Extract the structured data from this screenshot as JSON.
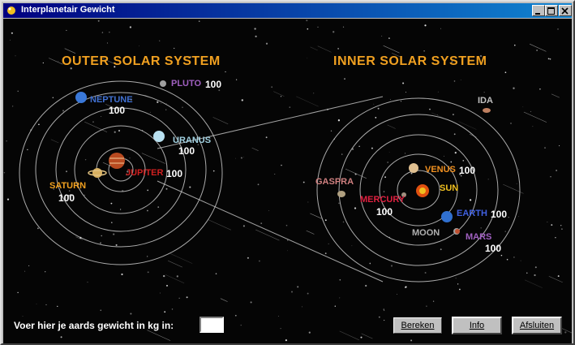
{
  "window": {
    "title": "Interplanetair Gewicht"
  },
  "headings": {
    "outer": "OUTER SOLAR SYSTEM",
    "inner": "INNER SOLAR SYSTEM"
  },
  "planets": {
    "pluto": {
      "name": "PLUTO",
      "value": "100",
      "color": "#a060c0"
    },
    "neptune": {
      "name": "NEPTUNE",
      "value": "100",
      "color": "#4070d0"
    },
    "uranus": {
      "name": "URANUS",
      "value": "100",
      "color": "#a0d0e0"
    },
    "jupiter": {
      "name": "JUPITER",
      "value": "100",
      "color": "#d02020"
    },
    "saturn": {
      "name": "SATURN",
      "value": "100",
      "color": "#f0a020"
    },
    "ida": {
      "name": "IDA",
      "value": "",
      "color": "#c0c0c0"
    },
    "gaspra": {
      "name": "GASPRA",
      "value": "",
      "color": "#d08080"
    },
    "venus": {
      "name": "VENUS",
      "value": "100",
      "color": "#f09020"
    },
    "sun": {
      "name": "SUN",
      "value": "",
      "color": "#f0c020"
    },
    "mercury": {
      "name": "MERCURY",
      "value": "100",
      "color": "#e02040"
    },
    "earth": {
      "name": "EARTH",
      "value": "100",
      "color": "#4060e0"
    },
    "moon": {
      "name": "MOON",
      "value": "",
      "color": "#b0b0b0"
    },
    "mars": {
      "name": "MARS",
      "value": "100",
      "color": "#a060c0"
    }
  },
  "form": {
    "prompt": "Voer hier je aards gewicht in kg in:",
    "weight_value": ""
  },
  "buttons": {
    "calculate": "Bereken",
    "info": "Info",
    "close": "Afsluiten"
  }
}
